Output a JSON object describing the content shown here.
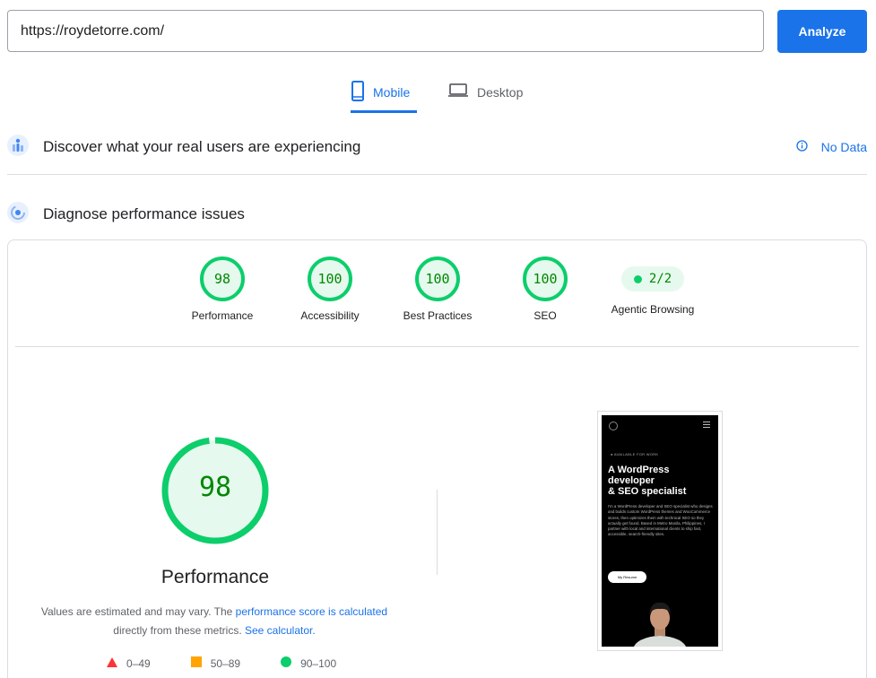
{
  "url_bar": {
    "value": "https://roydetorre.com/",
    "analyze_label": "Analyze"
  },
  "tabs": [
    {
      "label": "Mobile",
      "icon": "smartphone-icon",
      "active": true
    },
    {
      "label": "Desktop",
      "icon": "laptop-icon",
      "active": false
    }
  ],
  "sections": {
    "discover": {
      "title": "Discover what your real users are experiencing",
      "status": "No Data",
      "icon": "field-data-icon"
    },
    "diagnose": {
      "title": "Diagnose performance issues",
      "icon": "lab-data-icon"
    }
  },
  "gauges": [
    {
      "label": "Performance",
      "score": "98"
    },
    {
      "label": "Accessibility",
      "score": "100"
    },
    {
      "label": "Best Practices",
      "score": "100"
    },
    {
      "label": "SEO",
      "score": "100"
    },
    {
      "label": "Agentic Browsing",
      "score": "2/2"
    }
  ],
  "main": {
    "score": "98",
    "score_value": 98,
    "title": "Performance",
    "note_prefix": "Values are estimated and may vary. The ",
    "note_link": "performance score is calculated",
    "note_middle": " directly from these metrics. ",
    "note_link2": "See calculator.",
    "legend": [
      {
        "range": "0–49",
        "shape": "triangle",
        "color": "#ff3333"
      },
      {
        "range": "50–89",
        "shape": "square",
        "color": "#ffa400"
      },
      {
        "range": "90–100",
        "shape": "circle",
        "color": "#0cce6b"
      }
    ]
  },
  "screenshot": {
    "badge": "● AVAILABLE FOR WORK",
    "headline": "A WordPress\ndeveloper\n& SEO specialist",
    "body": "I'm a WordPress developer and SEO specialist who designs and builds custom WordPress themes and WooCommerce stores, then optimizes them with technical SEO so they actually get found. Based in Metro Manila, Philippines, I partner with local and international clients to ship fast, accessible, search-friendly sites.",
    "button": "My Resume"
  },
  "colors": {
    "accent": "#1a73e8",
    "pass": "#0cce6b",
    "pass_bg": "#e6f9ee",
    "pass_text": "#008800"
  }
}
